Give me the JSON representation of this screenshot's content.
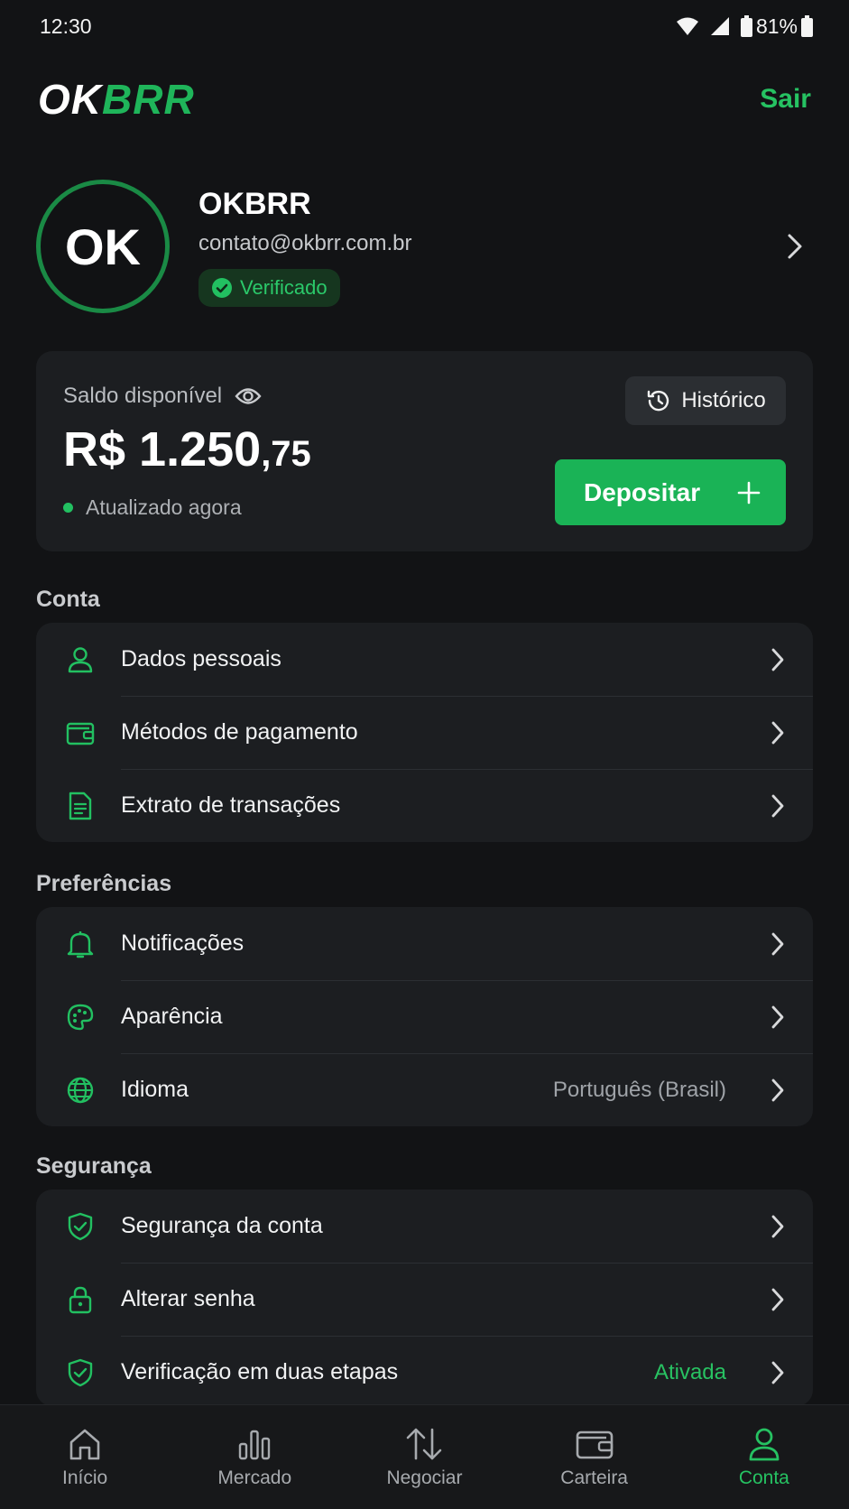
{
  "status_bar": {
    "time": "12:30",
    "battery": "81%"
  },
  "header": {
    "logo_ok": "OK",
    "logo_brr": "BRR",
    "logout": "Sair"
  },
  "profile": {
    "initials": "OK",
    "name": "OKBRR",
    "email": "contato@okbrr.com.br",
    "badge": "Verificado"
  },
  "balance": {
    "label": "Saldo disponível",
    "currency": "R$",
    "integer": "1.250",
    "cents": ",75",
    "updated": "Atualizado agora",
    "history_button": "Histórico",
    "deposit_button": "Depositar"
  },
  "sections": {
    "conta": {
      "title": "Conta",
      "items": [
        {
          "label": "Dados pessoais",
          "icon": "user-icon"
        },
        {
          "label": "Métodos de pagamento",
          "icon": "wallet-icon"
        },
        {
          "label": "Extrato de transações",
          "icon": "document-icon"
        }
      ]
    },
    "preferencias": {
      "title": "Preferências",
      "items": [
        {
          "label": "Notificações",
          "icon": "bell-icon"
        },
        {
          "label": "Aparência",
          "icon": "palette-icon"
        },
        {
          "label": "Idioma",
          "value": "Português (Brasil)",
          "icon": "globe-icon"
        }
      ]
    },
    "seguranca": {
      "title": "Segurança",
      "items": [
        {
          "label": "Segurança da conta",
          "icon": "shield-icon"
        },
        {
          "label": "Alterar senha",
          "icon": "lock-icon"
        },
        {
          "label": "Verificação em duas etapas",
          "value": "Ativada",
          "icon": "shield-check-icon"
        }
      ]
    }
  },
  "bottom_nav": {
    "items": [
      {
        "label": "Início",
        "icon": "home-icon"
      },
      {
        "label": "Mercado",
        "icon": "bar-chart-icon"
      },
      {
        "label": "Negociar",
        "icon": "swap-icon"
      },
      {
        "label": "Carteira",
        "icon": "wallet-icon"
      },
      {
        "label": "Conta",
        "icon": "user-icon",
        "active": true
      }
    ]
  },
  "colors": {
    "accent": "#1ab356",
    "background": "#121315",
    "card": "#1c1e21"
  }
}
